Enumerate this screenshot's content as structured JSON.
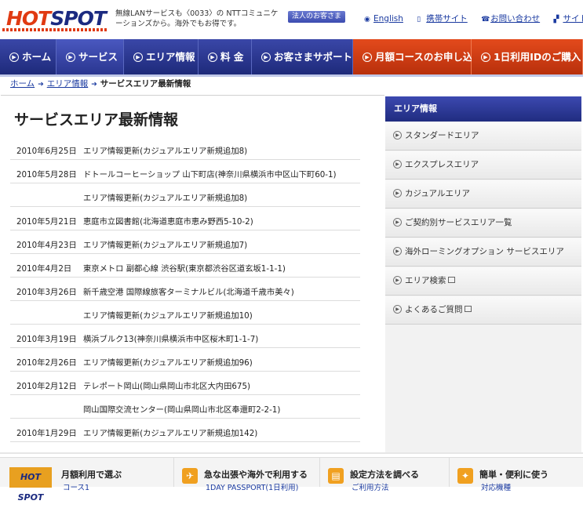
{
  "header": {
    "logo": {
      "part1": "HOT",
      "part2": "SPOT"
    },
    "tagline": "無線LANサービスも〈0033〉の NTTコミュニケーションズから。海外でもお得です。",
    "corporate_button": "法人のお客さま",
    "links": [
      {
        "icon": "globe-icon",
        "glyph": "◉",
        "label": "English"
      },
      {
        "icon": "mobile-icon",
        "glyph": "▯",
        "label": "携帯サイト"
      },
      {
        "icon": "phone-icon",
        "glyph": "☎",
        "label": "お問い合わせ"
      },
      {
        "icon": "sitemap-icon",
        "glyph": "▞",
        "label": "サイトマップ"
      }
    ]
  },
  "nav": [
    {
      "label": "ホーム"
    },
    {
      "label": "サービス"
    },
    {
      "label": "エリア情報"
    },
    {
      "label": "料 金"
    },
    {
      "label": "お客さまサポート"
    },
    {
      "label": "月額コースのお申し込み"
    },
    {
      "label": "1日利用IDのご購入"
    }
  ],
  "breadcrumb": {
    "home": "ホーム",
    "area": "エリア情報",
    "current": "サービスエリア最新情報",
    "sep": "➔"
  },
  "main": {
    "title": "サービスエリア最新情報",
    "news": [
      {
        "date": "2010年6月25日",
        "text": "エリア情報更新(カジュアルエリア新規追加8)"
      },
      {
        "date": "2010年5月28日",
        "text": "ドトールコーヒーショップ 山下町店(神奈川県横浜市中区山下町60-1)"
      },
      {
        "date": "",
        "text": "エリア情報更新(カジュアルエリア新規追加8)"
      },
      {
        "date": "2010年5月21日",
        "text": "恵庭市立図書館(北海道恵庭市恵み野西5-10-2)"
      },
      {
        "date": "2010年4月23日",
        "text": "エリア情報更新(カジュアルエリア新規追加7)"
      },
      {
        "date": "2010年4月2日",
        "text": "東京メトロ 副都心線 渋谷駅(東京都渋谷区道玄坂1-1-1)"
      },
      {
        "date": "2010年3月26日",
        "text": "新千歳空港 国際線旅客ターミナルビル(北海道千歳市美々)"
      },
      {
        "date": "",
        "text": "エリア情報更新(カジュアルエリア新規追加10)"
      },
      {
        "date": "2010年3月19日",
        "text": "横浜ブルク13(神奈川県横浜市中区桜木町1-1-7)"
      },
      {
        "date": "2010年2月26日",
        "text": "エリア情報更新(カジュアルエリア新規追加96)"
      },
      {
        "date": "2010年2月12日",
        "text": "テレポート岡山(岡山県岡山市北区大内田675)"
      },
      {
        "date": "",
        "text": "岡山国際交流センター(岡山県岡山市北区奉還町2-2-1)"
      },
      {
        "date": "2010年1月29日",
        "text": "エリア情報更新(カジュアルエリア新規追加142)"
      }
    ]
  },
  "sidebar": {
    "heading": "エリア情報",
    "items": [
      {
        "label": "スタンダードエリア",
        "external": false
      },
      {
        "label": "エクスプレスエリア",
        "external": false
      },
      {
        "label": "カジュアルエリア",
        "external": false
      },
      {
        "label": "ご契約別サービスエリア一覧",
        "external": false
      },
      {
        "label": "海外ローミングオプション サービスエリア",
        "external": false
      },
      {
        "label": "エリア検索",
        "external": true
      },
      {
        "label": "よくあるご質問",
        "external": true
      }
    ]
  },
  "footer": {
    "logo": "HOT SPOT",
    "items": [
      {
        "title": "月額利用で選ぶ",
        "sub": "コース1"
      },
      {
        "title": "急な出張や海外で利用する",
        "sub": "1DAY PASSPORT(1日利用)"
      },
      {
        "title": "設定方法を調べる",
        "sub": "ご利用方法"
      },
      {
        "title": "簡単・便利に使う",
        "sub": "対応機種"
      }
    ]
  },
  "colors": {
    "brand_blue": "#1e2a7a",
    "brand_orange": "#e03a12",
    "link_blue": "#1a3aa0"
  }
}
